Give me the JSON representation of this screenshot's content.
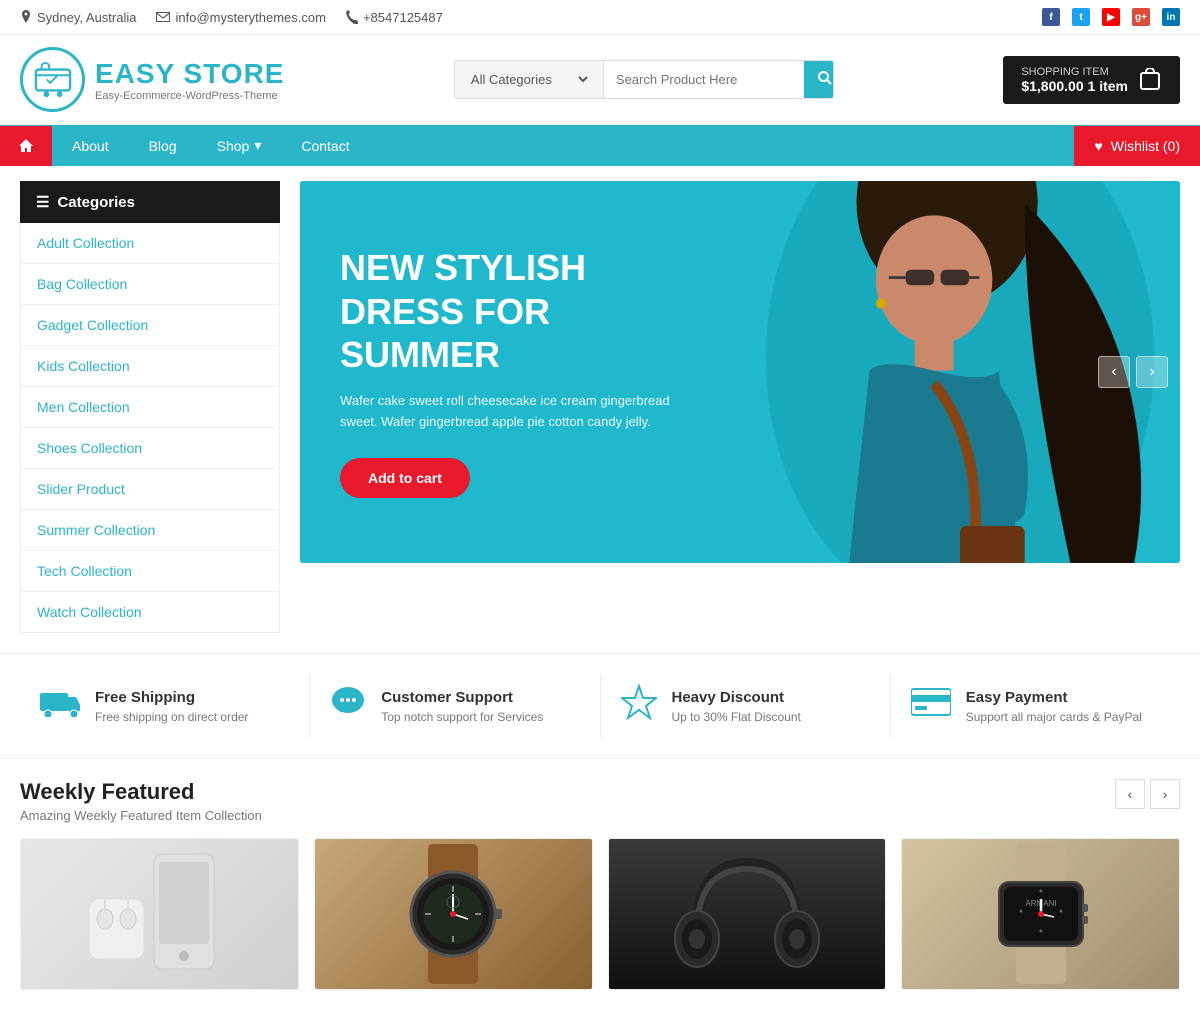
{
  "topbar": {
    "location": "Sydney, Australia",
    "email": "info@mysterythemes.com",
    "phone": "+8547125487",
    "socials": [
      "f",
      "t",
      "y",
      "g+",
      "in"
    ]
  },
  "header": {
    "logo_title": "EASY STORE",
    "logo_subtitle": "Easy-Ecommerce-WordPress-Theme",
    "search_placeholder": "Search Product Here",
    "search_category": "All Categories",
    "cart_title": "SHOPPING ITEM",
    "cart_price": "$1,800.00",
    "cart_items": "1 item"
  },
  "nav": {
    "home": "home",
    "items": [
      "About",
      "Blog",
      "Shop",
      "Contact"
    ],
    "wishlist": "Wishlist (0)"
  },
  "sidebar": {
    "header": "Categories",
    "items": [
      "Adult Collection",
      "Bag Collection",
      "Gadget Collection",
      "Kids Collection",
      "Men Collection",
      "Shoes Collection",
      "Slider Product",
      "Summer Collection",
      "Tech Collection",
      "Watch Collection"
    ]
  },
  "hero": {
    "title": "NEW STYLISH DRESS FOR SUMMER",
    "description": "Wafer cake sweet roll cheesecake ice cream gingerbread sweet. Wafer gingerbread apple pie cotton candy jelly.",
    "button": "Add to cart"
  },
  "features": [
    {
      "icon": "truck",
      "title": "Free Shipping",
      "desc": "Free shipping on direct order"
    },
    {
      "icon": "chat",
      "title": "Customer Support",
      "desc": "Top notch support for Services"
    },
    {
      "icon": "star",
      "title": "Heavy Discount",
      "desc": "Up to 30% Flat Discount"
    },
    {
      "icon": "card",
      "title": "Easy Payment",
      "desc": "Support all major cards & PayPal"
    }
  ],
  "weekly": {
    "title": "Weekly Featured",
    "subtitle": "Amazing Weekly Featured Item Collection",
    "products": [
      {
        "name": "Phone & Earbuds",
        "type": "phone"
      },
      {
        "name": "Luxury Watch",
        "type": "watch1"
      },
      {
        "name": "Headphones",
        "type": "headphone"
      },
      {
        "name": "Smart Watch",
        "type": "watch2"
      }
    ]
  }
}
